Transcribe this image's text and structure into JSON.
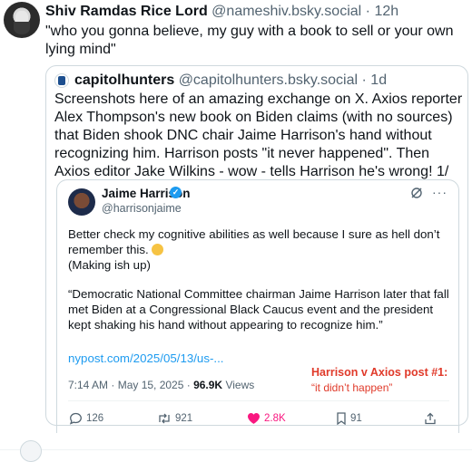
{
  "post": {
    "author_name": "Shiv Ramdas Rice Lord",
    "author_handle": "@nameshiv.bsky.social",
    "time": "12h",
    "text": "\"who you gonna believe, my guy with a book to sell or your own lying mind\""
  },
  "quoted": {
    "author_name": "capitolhunters",
    "author_handle": "@capitolhunters.bsky.social",
    "time": "1d",
    "text": "Screenshots here of an amazing exchange on X. Axios reporter Alex Thompson's new book on Biden claims (with no sources) that Biden shook DNC chair Jaime Harrison's hand without recognizing him. Harrison posts \"it never happened\". Then Axios editor Jake Wilkins - wow - tells Harrison he's wrong! 1/"
  },
  "tweet": {
    "name": "Jaime Harrison",
    "handle": "@harrisonjaime",
    "line1": "Better check my cognitive abilities as well because I sure as hell don’t remember this.",
    "line2": "(Making ish up)",
    "quote": "“Democratic National Committee chairman Jaime Harrison later that fall met Biden at a Congressional Black Caucus event and the president kept shaking his hand without appearing to recognize him.”",
    "link": "nypost.com/2025/05/13/us-...",
    "timestamp": "7:14 AM · May 15, 2025 · ",
    "views_count": "96.9K",
    "views_label": " Views",
    "replies": "126",
    "reposts": "921",
    "likes": "2.8K",
    "bookmarks": "91"
  },
  "annotation": {
    "title": "Harrison v Axios post #1:",
    "subtitle": "“it didn’t happen”"
  },
  "colors": {
    "link": "#1d9bf0",
    "like": "#f91880",
    "annotation": "#e03a2a",
    "muted": "#536471"
  }
}
